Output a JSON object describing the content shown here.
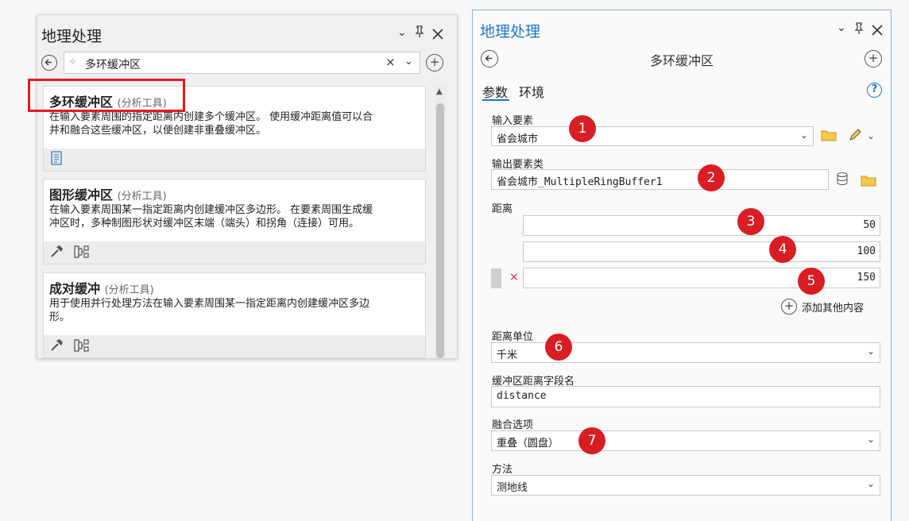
{
  "left": {
    "title": "地理处理",
    "search_value": "多环缓冲区",
    "cards": [
      {
        "title": "多环缓冲区",
        "sub": "(分析工具)",
        "desc1": "在输入要素周围的指定距离内创建多个缓冲区。 使用缓冲距离值可以合",
        "desc2": "并和融合这些缓冲区，以便创建非重叠缓冲区。"
      },
      {
        "title": "图形缓冲区",
        "sub": "(分析工具)",
        "desc1": "在输入要素周围某一指定距离内创建缓冲区多边形。 在要素周围生成缓",
        "desc2": "冲区时，多种制图形状对缓冲区末端（端头）和拐角（连接）可用。"
      },
      {
        "title": "成对缓冲",
        "sub": "(分析工具)",
        "desc1": "用于使用并行处理方法在输入要素周围某一指定距离内创建缓冲区多边",
        "desc2": "形。"
      }
    ]
  },
  "right": {
    "title": "地理处理",
    "tool_name": "多环缓冲区",
    "tab_params": "参数",
    "tab_env": "环境",
    "input_label": "输入要素",
    "input_value": "省会城市",
    "output_label": "输出要素类",
    "output_value": "省会城市_MultipleRingBuffer1",
    "distance_label": "距离",
    "distances": [
      "50",
      "100",
      "150"
    ],
    "add_more": "添加其他内容",
    "unit_label": "距离单位",
    "unit_value": "千米",
    "field_label": "缓冲区距离字段名",
    "field_value": "distance",
    "dissolve_label": "融合选项",
    "dissolve_value": "重叠（圆盘）",
    "method_label": "方法",
    "method_value": "测地线"
  },
  "badges": [
    "1",
    "2",
    "3",
    "4",
    "5",
    "6",
    "7"
  ],
  "colors": {
    "highlight": "#e3191f",
    "badge": "#d91d24",
    "accent": "#1f77c7",
    "panel_border": "#8ab4e0"
  }
}
